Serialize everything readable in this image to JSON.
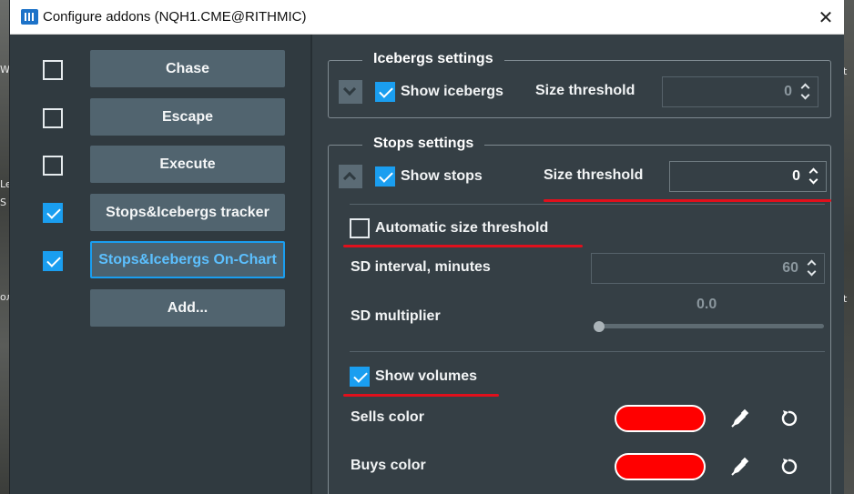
{
  "window": {
    "title": "Configure addons (NQH1.CME@RITHMIC)",
    "close_glyph": "✕"
  },
  "desktop": {
    "left_fragments": [
      "W",
      "Le",
      "S",
      "ол"
    ],
    "right_fragments": [
      "t",
      "t"
    ]
  },
  "addons": [
    {
      "label": "Chase",
      "checked": false,
      "active": false
    },
    {
      "label": "Escape",
      "checked": false,
      "active": false
    },
    {
      "label": "Execute",
      "checked": false,
      "active": false
    },
    {
      "label": "Stops&Icebergs tracker",
      "checked": true,
      "active": false
    },
    {
      "label": "Stops&Icebergs On-Chart",
      "checked": true,
      "active": true
    }
  ],
  "add_button": "Add...",
  "icebergs": {
    "title": "Icebergs settings",
    "show_label": "Show icebergs",
    "show_checked": true,
    "size_label": "Size threshold",
    "size_value": "0"
  },
  "stops": {
    "title": "Stops settings",
    "show_label": "Show stops",
    "show_checked": true,
    "size_label": "Size threshold",
    "size_value": "0",
    "auto_label": "Automatic size threshold",
    "auto_checked": false,
    "sd_interval_label": "SD interval, minutes",
    "sd_interval_value": "60",
    "sd_mult_label": "SD multiplier",
    "sd_mult_value": "0.0",
    "sd_mult_level": 0.0,
    "show_volumes_label": "Show volumes",
    "show_volumes_checked": true,
    "sells_label": "Sells color",
    "buys_label": "Buys color",
    "sells_color": "#ff0000",
    "buys_color": "#ff0000"
  },
  "colors": {
    "accent": "#1a9ef0",
    "annotation_red": "#e0101c"
  },
  "icons": {
    "eyedropper": "eyedropper-icon",
    "reset": "reset-icon"
  }
}
